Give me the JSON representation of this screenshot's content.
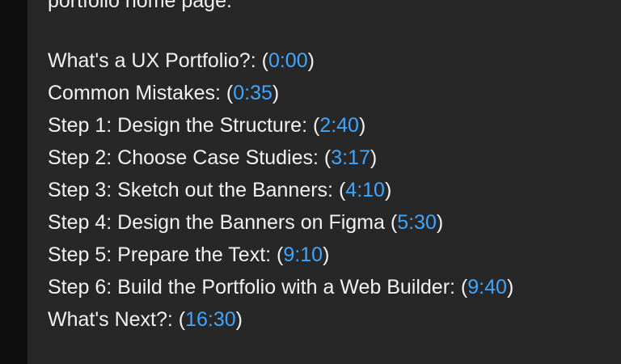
{
  "description": {
    "partial_line": "portfolio home page.",
    "chapters": [
      {
        "title": "What's a UX Portfolio?:",
        "timestamp": "0:00"
      },
      {
        "title": "Common Mistakes:",
        "timestamp": "0:35"
      },
      {
        "title": "Step 1: Design the Structure:",
        "timestamp": "2:40"
      },
      {
        "title": "Step 2: Choose Case Studies:",
        "timestamp": "3:17"
      },
      {
        "title": "Step 3: Sketch out the Banners:",
        "timestamp": "4:10"
      },
      {
        "title": "Step 4: Design the Banners on Figma",
        "timestamp": "5:30"
      },
      {
        "title": "Step 5: Prepare the Text:",
        "timestamp": "9:10"
      },
      {
        "title": "Step 6: Build the Portfolio with a Web Builder:",
        "timestamp": "9:40"
      },
      {
        "title": "What's Next?:",
        "timestamp": "16:30"
      }
    ]
  },
  "colors": {
    "page_background": "#0f0f0f",
    "panel_background": "#272727",
    "text": "#f1f1f1",
    "timestamp_link": "#3ea6ff"
  }
}
